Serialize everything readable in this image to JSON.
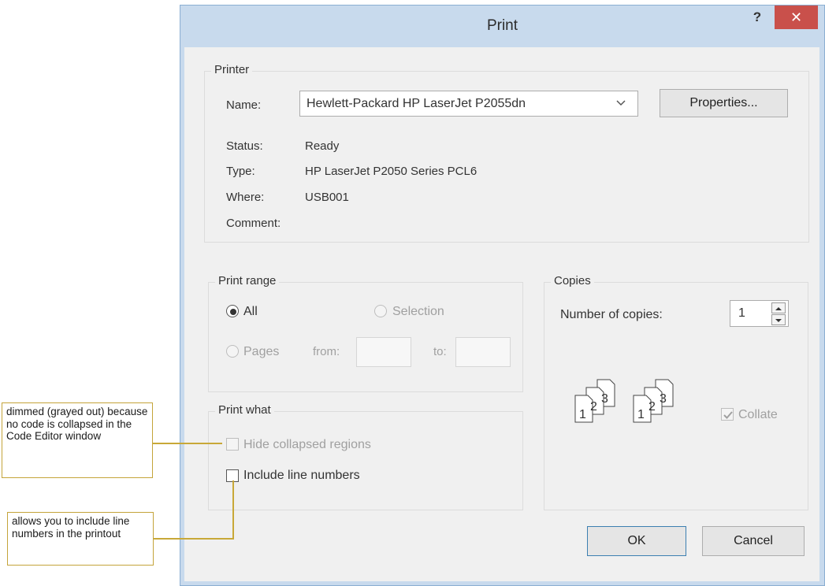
{
  "dialog": {
    "title": "Print",
    "help_label": "?",
    "close_label": "✕"
  },
  "printer": {
    "group_label": "Printer",
    "name_label": "Name:",
    "name_value": "Hewlett-Packard HP LaserJet P2055dn",
    "properties_label": "Properties...",
    "status_label": "Status:",
    "status_value": "Ready",
    "type_label": "Type:",
    "type_value": "HP LaserJet P2050 Series PCL6",
    "where_label": "Where:",
    "where_value": "USB001",
    "comment_label": "Comment:"
  },
  "print_range": {
    "group_label": "Print range",
    "all_label": "All",
    "all_selected": true,
    "selection_label": "Selection",
    "pages_label": "Pages",
    "from_label": "from:",
    "to_label": "to:"
  },
  "copies": {
    "group_label": "Copies",
    "number_label": "Number of copies:",
    "number_value": "1",
    "collate_label": "Collate",
    "collate_checked": true,
    "collate_pages": [
      "1",
      "2",
      "3"
    ]
  },
  "print_what": {
    "group_label": "Print what",
    "hide_collapsed_label": "Hide collapsed regions",
    "include_line_numbers_label": "Include line numbers"
  },
  "buttons": {
    "ok_label": "OK",
    "cancel_label": "Cancel"
  },
  "callouts": {
    "dimmed": "dimmed (grayed out) because no code is collapsed in the Code Editor window",
    "line_numbers": "allows you to include line numbers in the printout"
  },
  "colors": {
    "title_bar": "#c8daed",
    "close_button": "#c9504b",
    "callout_border": "#c4a43a"
  },
  "icons": {
    "help": "question-mark",
    "close": "x-mark",
    "combo_arrow": "chevron-down-icon",
    "spin_up": "triangle-up-icon",
    "spin_down": "triangle-down-icon",
    "collate": "stacked-pages-icon"
  }
}
